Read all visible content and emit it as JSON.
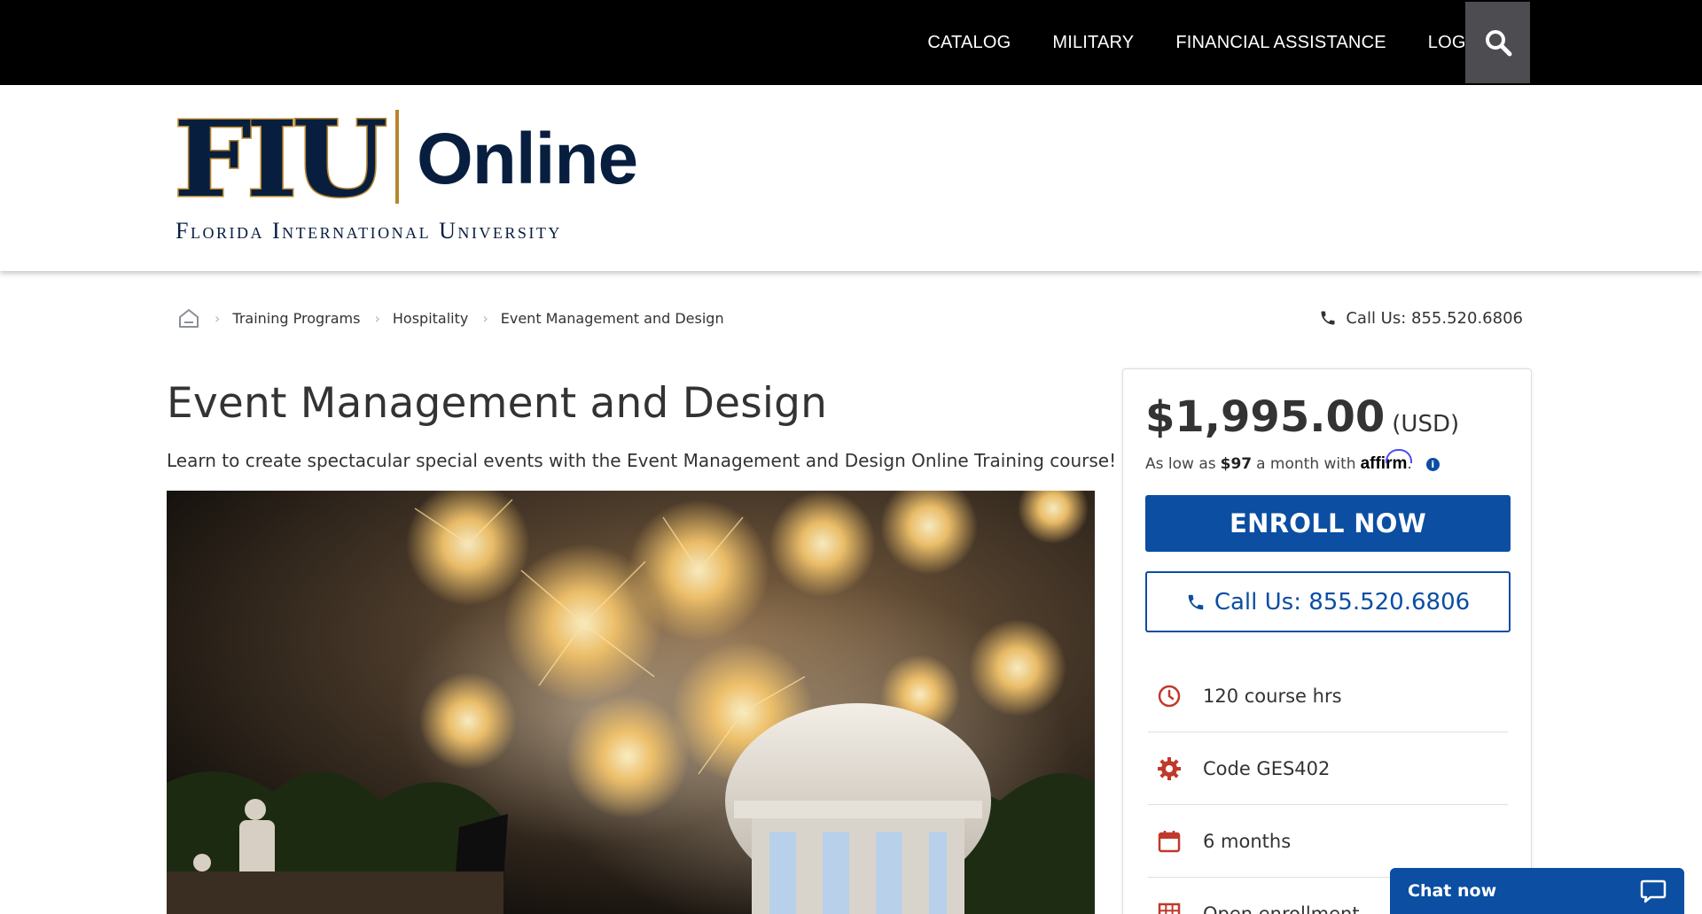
{
  "topnav": {
    "items": [
      "CATALOG",
      "MILITARY",
      "FINANCIAL ASSISTANCE",
      "LOGIN"
    ]
  },
  "logo": {
    "mark": "FIU",
    "product": "Online",
    "university": "Florida International University"
  },
  "breadcrumb": {
    "items": [
      "Training Programs",
      "Hospitality",
      "Event Management and Design"
    ]
  },
  "call_top": "Call Us: 855.520.6806",
  "course": {
    "title": "Event Management and Design",
    "subtitle": "Learn to create spectacular special events with the Event Management and Design Online Training course!"
  },
  "card": {
    "price": "$1,995.00",
    "currency": "(USD)",
    "affirm_prefix": "As low as",
    "affirm_amount": "$97",
    "affirm_suffix": "a month with",
    "affirm_brand": "affirm",
    "affirm_end": ".",
    "info_glyph": "i",
    "enroll_label": "ENROLL NOW",
    "call_label": "Call Us: 855.520.6806",
    "facts": [
      {
        "icon": "clock-icon",
        "text": "120 course hrs"
      },
      {
        "icon": "gear-icon",
        "text": "Code GES402"
      },
      {
        "icon": "calendar-icon",
        "text": "6 months"
      },
      {
        "icon": "grid-icon",
        "text": "Open enrollment"
      }
    ]
  },
  "chat": {
    "label": "Chat now"
  },
  "colors": {
    "primary": "#0b4ea2",
    "navy": "#081e3f",
    "gold": "#b6862c",
    "icon_red": "#c0392b",
    "topbar": "#000000"
  }
}
